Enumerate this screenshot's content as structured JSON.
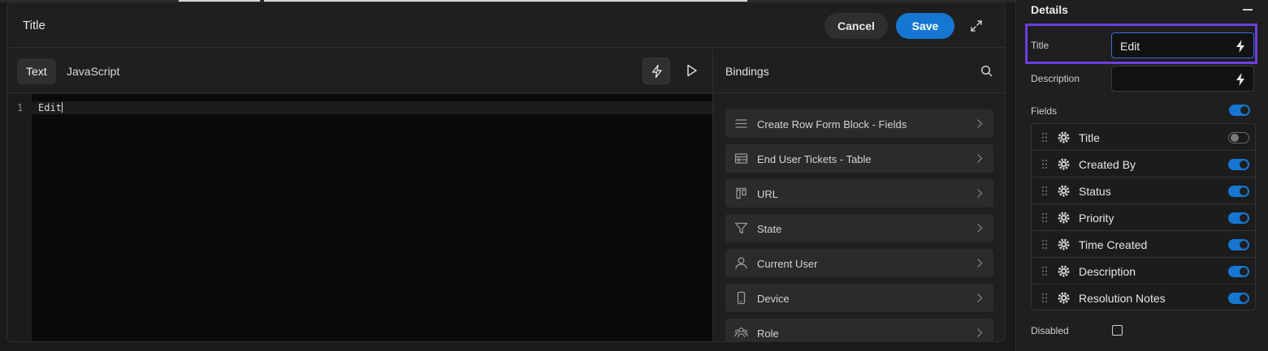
{
  "modal": {
    "title": "Title",
    "cancel_label": "Cancel",
    "save_label": "Save"
  },
  "editor": {
    "tabs": [
      {
        "label": "Text",
        "active": true
      },
      {
        "label": "JavaScript",
        "active": false
      }
    ],
    "lines": [
      {
        "number": "1",
        "text": "Edit"
      }
    ]
  },
  "bindings": {
    "title": "Bindings",
    "items": [
      {
        "label": "Create Row Form Block - Fields",
        "icon": "list-icon"
      },
      {
        "label": "End User Tickets - Table",
        "icon": "table-icon"
      },
      {
        "label": "URL",
        "icon": "url-icon"
      },
      {
        "label": "State",
        "icon": "filter-icon"
      },
      {
        "label": "Current User",
        "icon": "user-icon"
      },
      {
        "label": "Device",
        "icon": "device-icon"
      },
      {
        "label": "Role",
        "icon": "role-icon"
      }
    ]
  },
  "details": {
    "title": "Details",
    "title_label": "Title",
    "title_value": "Edit",
    "description_label": "Description",
    "description_value": "",
    "fields_label": "Fields",
    "fields_enabled": true,
    "fields": [
      {
        "name": "Title",
        "enabled": false
      },
      {
        "name": "Created By",
        "enabled": true
      },
      {
        "name": "Status",
        "enabled": true
      },
      {
        "name": "Priority",
        "enabled": true
      },
      {
        "name": "Time Created",
        "enabled": true
      },
      {
        "name": "Description",
        "enabled": true
      },
      {
        "name": "Resolution Notes",
        "enabled": true
      }
    ],
    "disabled_label": "Disabled",
    "disabled_checked": false
  },
  "colors": {
    "accent": "#1677d2",
    "highlight": "#6b3fe0"
  }
}
